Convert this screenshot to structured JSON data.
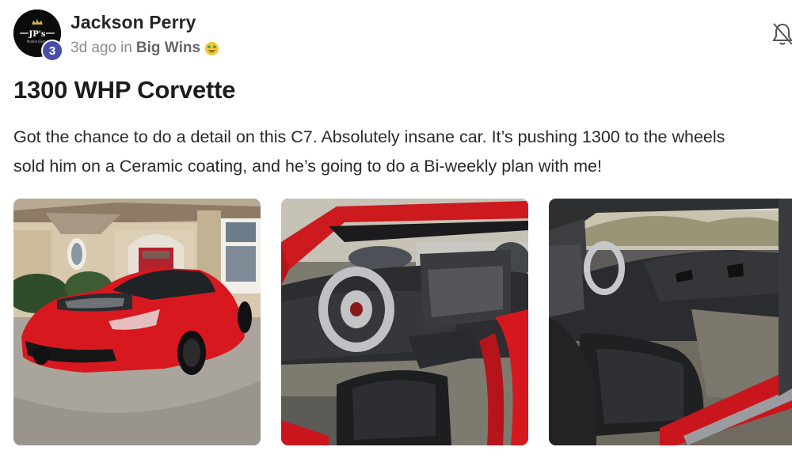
{
  "author": {
    "name": "Jackson Perry",
    "level": "3",
    "avatar_logo": "JP's",
    "avatar_sub": "Mobile Detail"
  },
  "meta": {
    "time_ago": "3d ago",
    "in_word": "in",
    "category": "Big Wins",
    "category_emoji": "money-mouth-face-icon"
  },
  "post": {
    "title": "1300 WHP Corvette",
    "body_line1": "Got the chance to do a detail on this C7. Absolutely insane car. It’s pushing 1300 to the wheels",
    "body_line2": "sold him on a Ceramic coating, and he’s going to do a Bi-weekly plan with me!"
  },
  "icons": {
    "notification": "bell-icon"
  },
  "photos": [
    {
      "alt": "Red Corvette exterior with hood open"
    },
    {
      "alt": "Corvette interior driver side"
    },
    {
      "alt": "Corvette interior passenger view"
    }
  ],
  "colors": {
    "level_badge": "#4a4ea8",
    "car_red": "#d8181f",
    "meta_gray": "#8c8c8c"
  }
}
